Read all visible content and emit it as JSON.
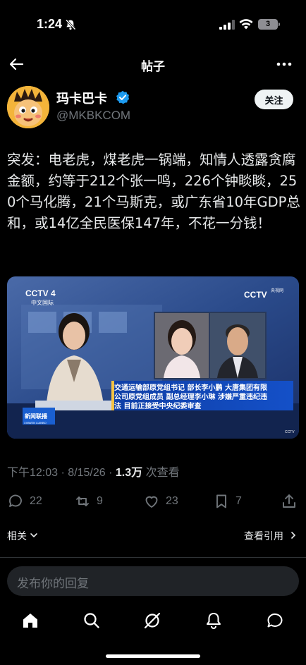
{
  "status_bar": {
    "time": "1:24",
    "battery": "3"
  },
  "header": {
    "title": "帖子"
  },
  "author": {
    "display_name": "玛卡巴卡",
    "handle": "@MKBKCOM",
    "follow_label": "关注"
  },
  "post": {
    "text": "突发：电老虎，煤老虎一锅端，知情人透露贪腐金额，约等于212个张一鸣，226个钟睒睒，250个马化腾，21个马斯克，或广东省10年GDP总和，或14亿全民医保147年，不花一分钱！"
  },
  "media": {
    "channel_logo": "CCTV 4",
    "channel_sub": "中文国际",
    "right_logo": "CCTV",
    "right_logo_sub": "央视网",
    "program_logo": "新闻联播",
    "program_logo_sub": "XINWEN LIANBO",
    "caption_lines": [
      "交通运输部原党组书记 部长李小鹏 大唐集团有限",
      "公司原党组成员 副总经理李小琳 涉嫌严重违纪违",
      "法 目前正接受中央纪委审查"
    ],
    "corner_badge": "CCTV"
  },
  "meta": {
    "timestamp": "下午12:03 · 8/15/26 · ",
    "views": "1.3万",
    "views_suffix": " 次查看"
  },
  "actions": {
    "replies": "22",
    "reposts": "9",
    "likes": "23",
    "bookmarks": "7"
  },
  "related": {
    "label": "相关",
    "quotes_label": "查看引用"
  },
  "reply": {
    "placeholder": "发布你的回复"
  },
  "colors": {
    "background": "#000000",
    "accent": "#1d9bf0",
    "muted": "#71767b",
    "text": "#e7e9ea"
  }
}
